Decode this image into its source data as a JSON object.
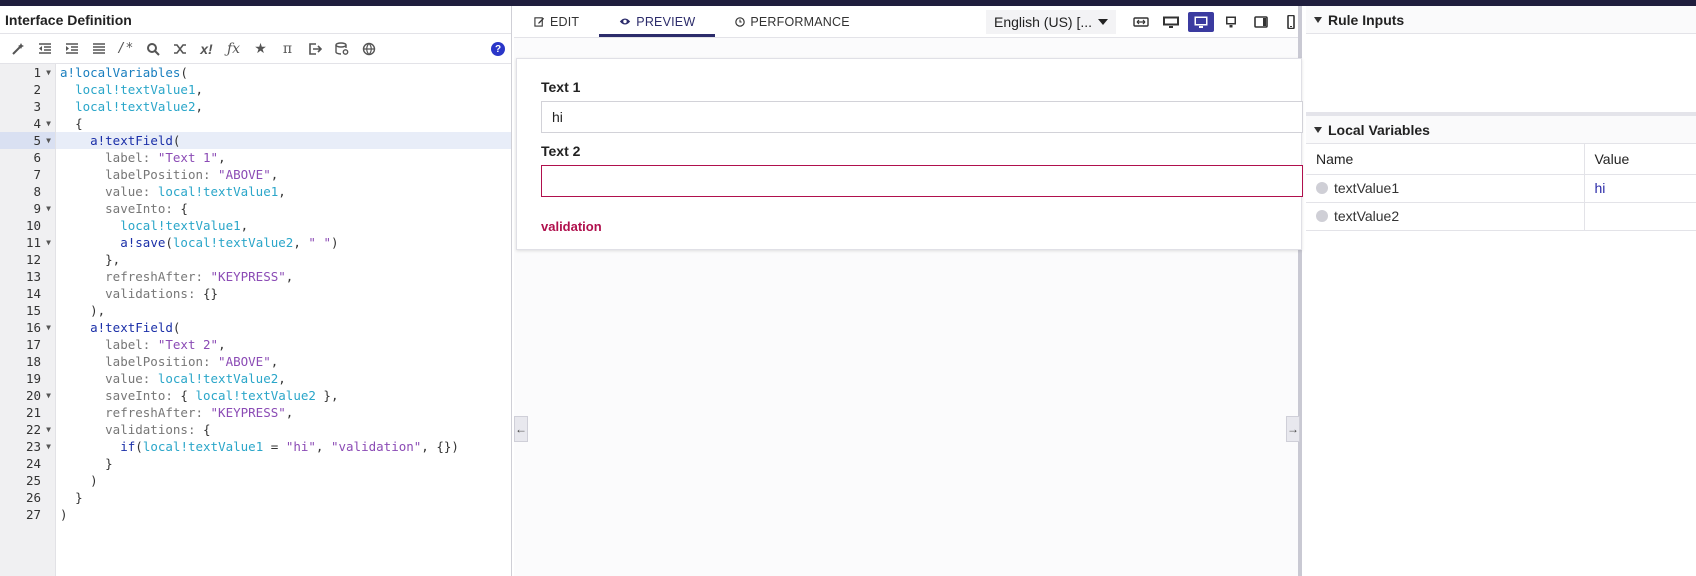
{
  "left": {
    "title": "Interface Definition",
    "toolbar_icons": [
      "wand-icon",
      "outdent-icon",
      "indent-icon",
      "list-icon",
      "comment-icon",
      "search-icon",
      "shuffle-icon",
      "x-bang-icon",
      "function-icon",
      "star-icon",
      "pi-icon",
      "export-icon",
      "database-icon",
      "globe-icon"
    ],
    "help": "?"
  },
  "code": {
    "lines": [
      {
        "n": "1",
        "fold": true
      },
      {
        "n": "2"
      },
      {
        "n": "3"
      },
      {
        "n": "4",
        "fold": true
      },
      {
        "n": "5",
        "fold": true,
        "hl": true
      },
      {
        "n": "6"
      },
      {
        "n": "7"
      },
      {
        "n": "8"
      },
      {
        "n": "9",
        "fold": true
      },
      {
        "n": "10"
      },
      {
        "n": "11",
        "fold": true
      },
      {
        "n": "12"
      },
      {
        "n": "13"
      },
      {
        "n": "14"
      },
      {
        "n": "15"
      },
      {
        "n": "16",
        "fold": true
      },
      {
        "n": "17"
      },
      {
        "n": "18"
      },
      {
        "n": "19"
      },
      {
        "n": "20",
        "fold": true
      },
      {
        "n": "21"
      },
      {
        "n": "22",
        "fold": true
      },
      {
        "n": "23",
        "fold": true
      },
      {
        "n": "24"
      },
      {
        "n": "25"
      },
      {
        "n": "26"
      },
      {
        "n": "27"
      }
    ],
    "text": {
      "l1a": "a!localVariables",
      "l1b": "(",
      "l2": "local!textValue1",
      "l3": "local!textValue2",
      "l4": "{",
      "l5a": "a!textField",
      "l5b": "(",
      "l6a": "label: ",
      "l6b": "\"Text 1\"",
      "l7a": "labelPosition: ",
      "l7b": "\"ABOVE\"",
      "l8a": "value: ",
      "l8b": "local!textValue1",
      "l9a": "saveInto: ",
      "l9b": "{",
      "l10": "local!textValue1",
      "l11a": "a!save",
      "l11b": "(",
      "l11c": "local!textValue2",
      "l11d": ", ",
      "l11e": "\" \"",
      "l11f": ")",
      "l12": "},",
      "l13a": "refreshAfter: ",
      "l13b": "\"KEYPRESS\"",
      "l14a": "validations: ",
      "l14b": "{}",
      "l15": "),",
      "l16a": "a!textField",
      "l16b": "(",
      "l17a": "label: ",
      "l17b": "\"Text 2\"",
      "l18a": "labelPosition: ",
      "l18b": "\"ABOVE\"",
      "l19a": "value: ",
      "l19b": "local!textValue2",
      "l20a": "saveInto: ",
      "l20b": "{ ",
      "l20c": "local!textValue2",
      "l20d": " },",
      "l21a": "refreshAfter: ",
      "l21b": "\"KEYPRESS\"",
      "l22a": "validations: ",
      "l22b": "{",
      "l23a": "if",
      "l23b": "(",
      "l23c": "local!textValue1",
      "l23d": " = ",
      "l23e": "\"hi\"",
      "l23f": ", ",
      "l23g": "\"validation\"",
      "l23h": ", {})",
      "l24": "}",
      "l25": ")",
      "l26": "}",
      "l27": ")",
      "comma": ","
    }
  },
  "middle": {
    "tabs": [
      {
        "label": "EDIT",
        "icon": "edit-icon"
      },
      {
        "label": "PREVIEW",
        "icon": "eye-icon"
      },
      {
        "label": "PERFORMANCE",
        "icon": "clock-icon"
      }
    ],
    "language": "English (US) [...",
    "form": {
      "field1_label": "Text 1",
      "field1_value": "hi",
      "field2_label": "Text 2",
      "field2_value": "",
      "validation_message": "validation"
    },
    "collapse_left": "←",
    "collapse_right": "→"
  },
  "right": {
    "rule_inputs_title": "Rule Inputs",
    "local_vars_title": "Local Variables",
    "columns": [
      "Name",
      "Value"
    ],
    "rows": [
      {
        "name": "textValue1",
        "value": "hi"
      },
      {
        "name": "textValue2",
        "value": ""
      }
    ]
  },
  "colors": {
    "accent": "#2c2c6b",
    "error": "#b0104d",
    "topbar": "#1f1e3d"
  }
}
